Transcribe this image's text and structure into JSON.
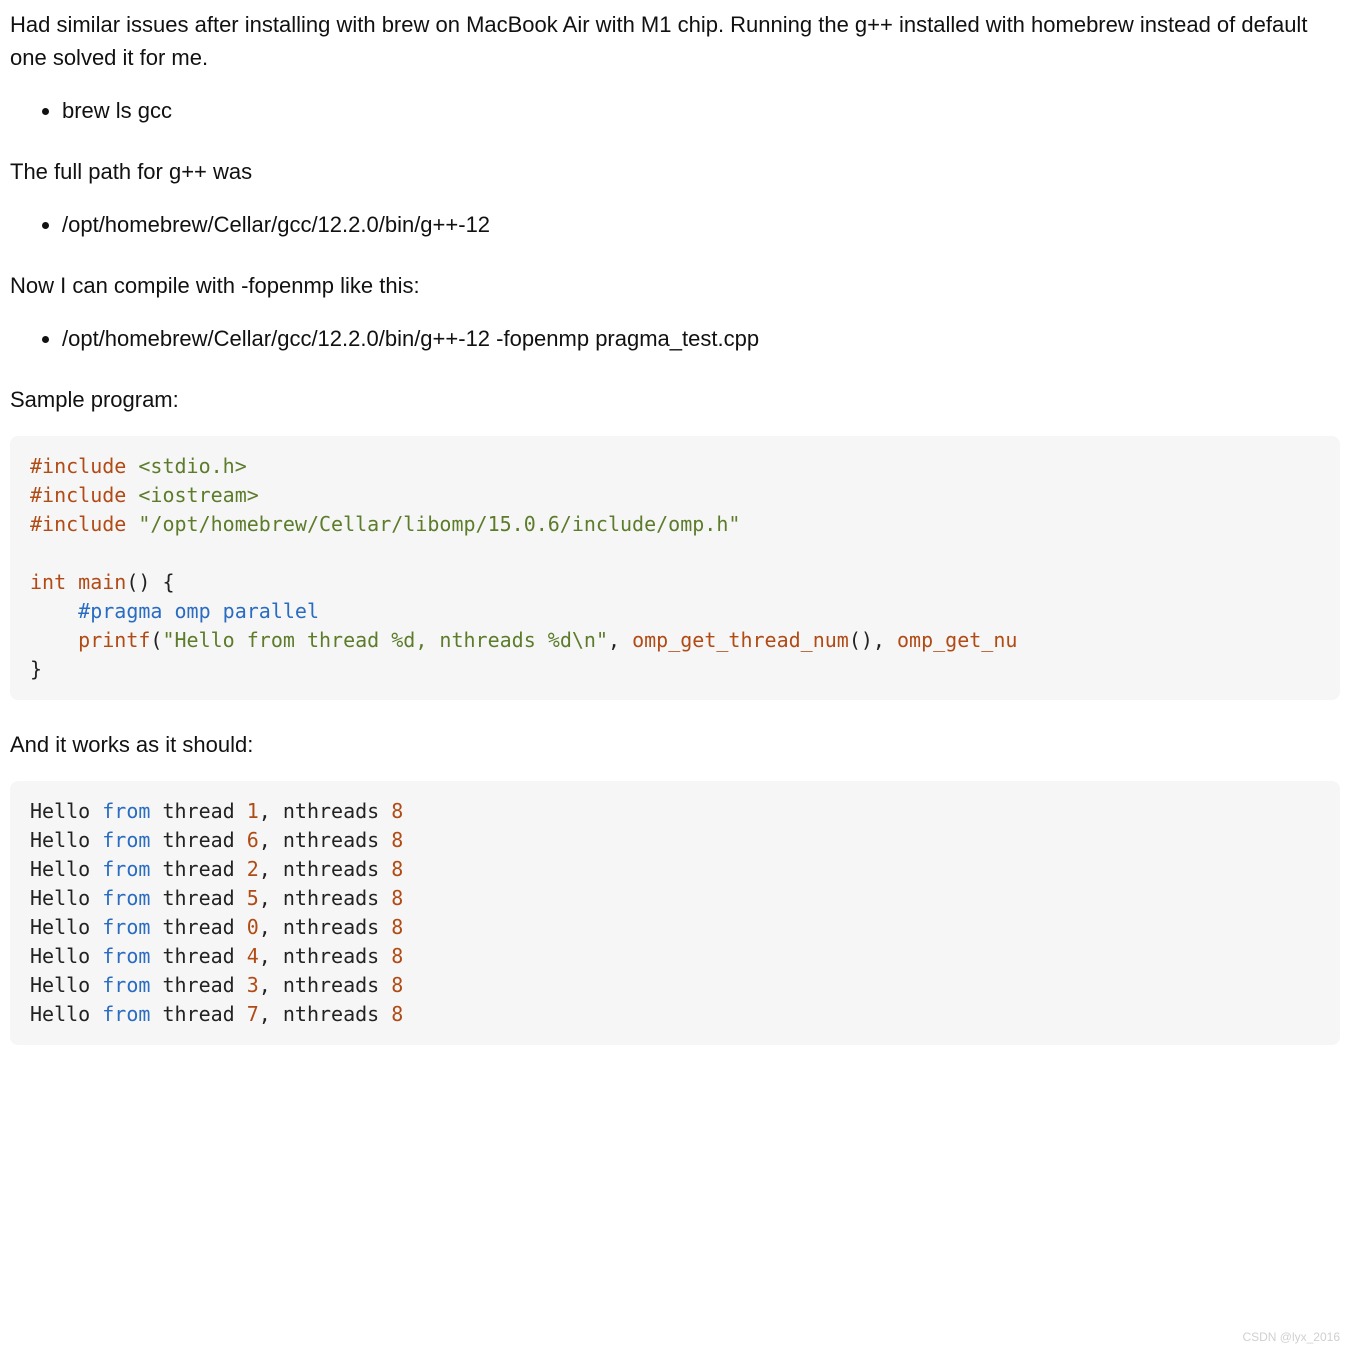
{
  "para1": "Had similar issues after installing with brew on MacBook Air with M1 chip. Running the g++ installed with homebrew instead of default one solved it for me.",
  "list1": [
    "brew ls gcc"
  ],
  "para2": "The full path for g++ was",
  "list2": [
    "/opt/homebrew/Cellar/gcc/12.2.0/bin/g++-12"
  ],
  "para3": "Now I can compile with -fopenmp like this:",
  "list3": [
    "/opt/homebrew/Cellar/gcc/12.2.0/bin/g++-12 -fopenmp pragma_test.cpp"
  ],
  "para4": "Sample program:",
  "code1": {
    "l1a": "#include ",
    "l1b": "<stdio.h>",
    "l2a": "#include ",
    "l2b": "<iostream>",
    "l3a": "#include ",
    "l3b": "\"/opt/homebrew/Cellar/libomp/15.0.6/include/omp.h\"",
    "l4a": "int",
    "l4b": " ",
    "l4c": "main",
    "l4d": "() {",
    "l5a": "    ",
    "l5b": "#pragma omp parallel",
    "l6a": "    ",
    "l6b": "printf",
    "l6c": "(",
    "l6d": "\"Hello from thread %d, nthreads %d\\n\"",
    "l6e": ", ",
    "l6f": "omp_get_thread_num",
    "l6g": "(), ",
    "l6h": "omp_get_nu",
    "l7": "}"
  },
  "para5": "And it works as it should:",
  "output": {
    "threads": [
      1,
      6,
      2,
      5,
      0,
      4,
      3,
      7
    ],
    "nthreads": 8,
    "prefix": "Hello ",
    "from": "from",
    "mid1": " thread ",
    "mid2": ", nthreads "
  },
  "watermark": "CSDN @lyx_2016"
}
